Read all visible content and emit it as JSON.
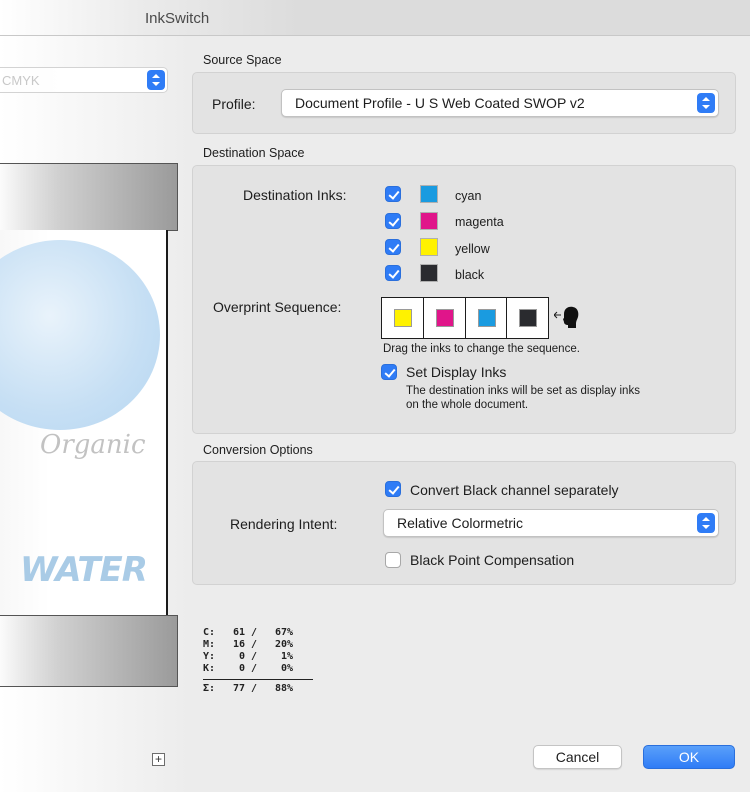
{
  "window": {
    "title": "InkSwitch"
  },
  "left_panel": {
    "preset_value": "CMYK",
    "preview_art": {
      "text1": "Organic",
      "text2": "WATER"
    },
    "ink_readout": [
      {
        "ink": "C:",
        "a": "61",
        "b": "67%"
      },
      {
        "ink": "M:",
        "a": "16",
        "b": "20%"
      },
      {
        "ink": "Y:",
        "a": "0",
        "b": "1%"
      },
      {
        "ink": "K:",
        "a": "0",
        "b": "0%"
      }
    ],
    "ink_sum": {
      "ink": "Σ:",
      "a": "77",
      "b": "88%"
    },
    "add_label": "+"
  },
  "source_space": {
    "heading": "Source Space",
    "profile_label": "Profile:",
    "profile_value": "Document Profile - U S  Web Coated  SWOP  v2"
  },
  "destination_space": {
    "heading": "Destination Space",
    "inks_label": "Destination Inks:",
    "inks": [
      {
        "name": "cyan",
        "color": "#1a9be0",
        "checked": true
      },
      {
        "name": "magenta",
        "color": "#e0158a",
        "checked": true
      },
      {
        "name": "yellow",
        "color": "#fff200",
        "checked": true
      },
      {
        "name": "black",
        "color": "#2a2b2f",
        "checked": true
      }
    ],
    "overprint_label": "Overprint Sequence:",
    "overprint_sequence": [
      "#fff200",
      "#e0158a",
      "#1a9be0",
      "#2a2b2f"
    ],
    "drag_hint": "Drag the inks to change the sequence.",
    "set_display_inks_label": "Set Display Inks",
    "set_display_inks_checked": true,
    "display_inks_note_line1": "The destination inks will be set as display inks",
    "display_inks_note_line2": "on the whole document."
  },
  "conversion_options": {
    "heading": "Conversion Options",
    "convert_black_label": "Convert Black channel separately",
    "convert_black_checked": true,
    "rendering_intent_label": "Rendering Intent:",
    "rendering_intent_value": "Relative Colormetric",
    "bpc_label": "Black Point Compensation",
    "bpc_checked": false
  },
  "buttons": {
    "cancel": "Cancel",
    "ok": "OK"
  },
  "colors": {
    "accent": "#2f7cf6",
    "panel": "#e3e3e3"
  }
}
